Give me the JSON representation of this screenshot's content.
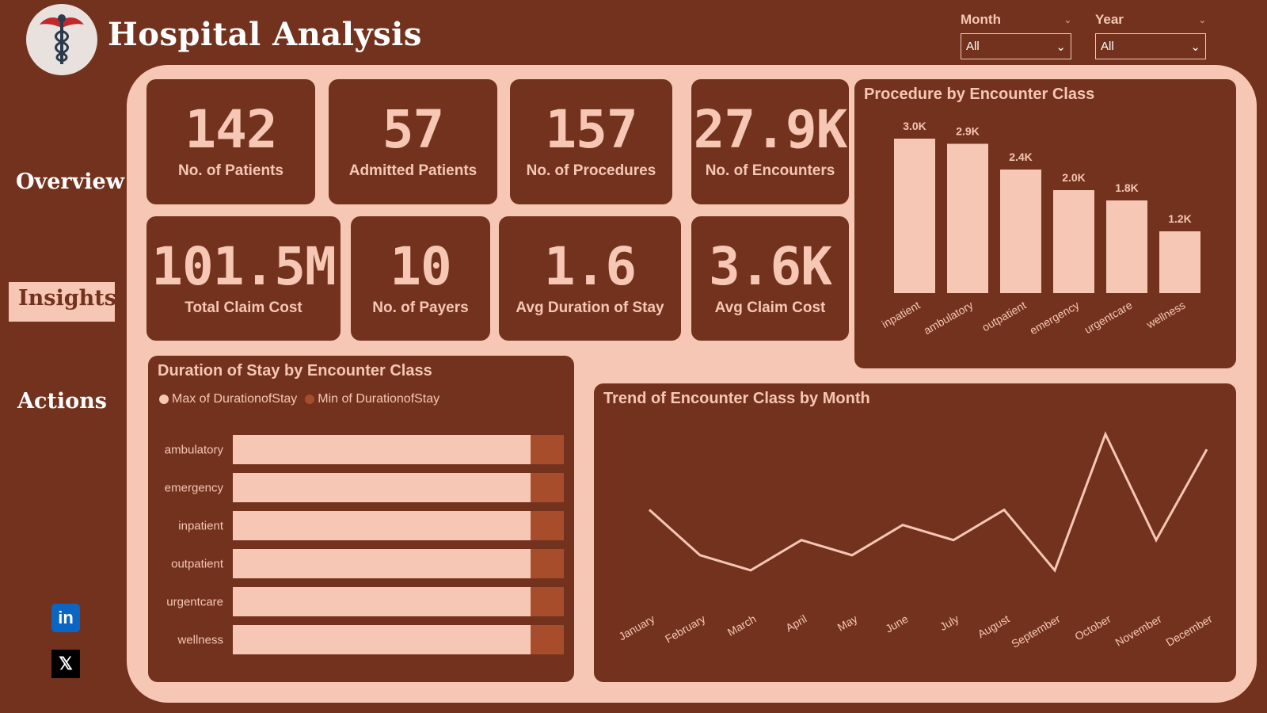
{
  "header": {
    "title": "Hospital Analysis",
    "logo_icon": "caduceus-icon"
  },
  "filters": [
    {
      "label": "Month",
      "value": "All"
    },
    {
      "label": "Year",
      "value": "All"
    }
  ],
  "nav": {
    "items": [
      {
        "label": "Overview",
        "active": false
      },
      {
        "label": "Insights",
        "active": true
      },
      {
        "label": "Actions",
        "active": false
      }
    ]
  },
  "social": {
    "linkedin_label": "in",
    "x_label": "𝕏"
  },
  "kpis": [
    {
      "value": "142",
      "label": "No. of Patients"
    },
    {
      "value": "57",
      "label": "Admitted Patients"
    },
    {
      "value": "157",
      "label": "No. of Procedures"
    },
    {
      "value": "27.9K",
      "label": "No. of Encounters"
    },
    {
      "value": "101.5M",
      "label": "Total Claim Cost"
    },
    {
      "value": "10",
      "label": "No. of Payers"
    },
    {
      "value": "1.6",
      "label": "Avg Duration of Stay"
    },
    {
      "value": "3.6K",
      "label": "Avg Claim Cost"
    }
  ],
  "colors": {
    "background": "#73321e",
    "panel": "#f5c7b4",
    "accent": "#a84d2b",
    "text_light": "#ffffff"
  },
  "chart_data": [
    {
      "type": "bar",
      "title": "Procedure by Encounter Class",
      "categories": [
        "inpatient",
        "ambulatory",
        "outpatient",
        "emergency",
        "urgentcare",
        "wellness"
      ],
      "values": [
        3000,
        2900,
        2400,
        2000,
        1800,
        1200
      ],
      "data_labels": [
        "3.0K",
        "2.9K",
        "2.4K",
        "2.0K",
        "1.8K",
        "1.2K"
      ],
      "ylim": [
        0,
        3000
      ],
      "grid": false
    },
    {
      "type": "bar",
      "orientation": "horizontal",
      "title": "Duration of Stay by Encounter Class",
      "categories": [
        "ambulatory",
        "emergency",
        "inpatient",
        "outpatient",
        "urgentcare",
        "wellness"
      ],
      "series": [
        {
          "name": "Max of DurationofStay",
          "values": [
            0.9,
            0.9,
            0.9,
            0.9,
            0.9,
            0.9
          ]
        },
        {
          "name": "Min of DurationofStay",
          "values": [
            0.1,
            0.1,
            0.1,
            0.1,
            0.1,
            0.1
          ]
        }
      ],
      "stacked": true,
      "legend": "top-left",
      "grid": false
    },
    {
      "type": "line",
      "title": "Trend of Encounter Class by Month",
      "categories": [
        "January",
        "February",
        "March",
        "April",
        "May",
        "June",
        "July",
        "August",
        "September",
        "October",
        "November",
        "December"
      ],
      "values": [
        2400,
        2100,
        2000,
        2200,
        2100,
        2300,
        2200,
        2400,
        2000,
        2900,
        2200,
        2800
      ],
      "ylim": [
        1900,
        3000
      ],
      "grid": false
    }
  ]
}
